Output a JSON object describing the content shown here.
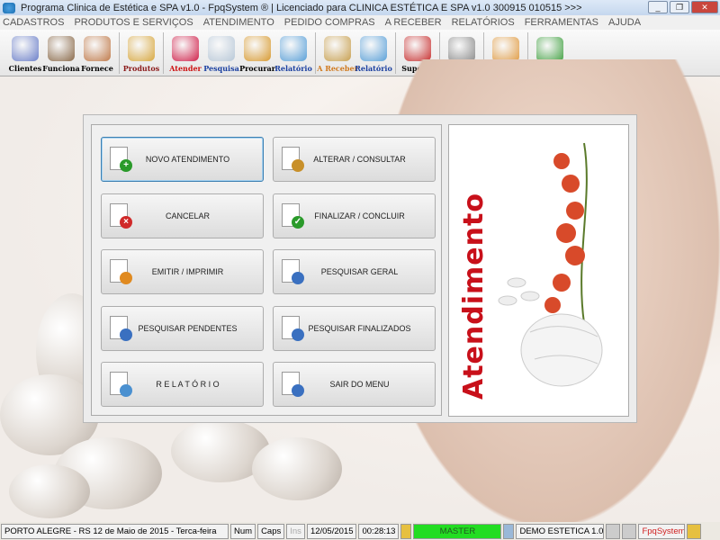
{
  "title": "Programa Clinica de Estética e SPA v1.0 - FpqSystem ® | Licenciado para  CLINICA ESTÉTICA E SPA v1.0 300915 010515 >>>",
  "window_buttons": {
    "minimize": "_",
    "restore": "❐",
    "close": "✕"
  },
  "menu": [
    "CADASTROS",
    "PRODUTOS E SERVIÇOS",
    "ATENDIMENTO",
    "PEDIDO COMPRAS",
    "A RECEBER",
    "RELATÓRIOS",
    "FERRAMENTAS",
    "AJUDA"
  ],
  "toolbar": [
    {
      "label": "Clientes",
      "color": "#000000",
      "icon": "#6b7fc9"
    },
    {
      "label": "Funciona",
      "color": "#000000",
      "icon": "#8a6a4a"
    },
    {
      "label": "Fornece",
      "color": "#000000",
      "icon": "#c07a4a"
    },
    {
      "label": "Produtos",
      "color": "#8b1a1a",
      "icon": "#d8a840"
    },
    {
      "label": "Atender",
      "color": "#cc1111",
      "icon": "#d0204a"
    },
    {
      "label": "Pesquisa",
      "color": "#1a3fa0",
      "icon": "#b8c8d8"
    },
    {
      "label": "Procurar",
      "color": "#000000",
      "icon": "#d89a30"
    },
    {
      "label": "Relatório",
      "color": "#1a3fa0",
      "icon": "#5aa0d8"
    },
    {
      "label": "A Receber",
      "color": "#d07a20",
      "icon": "#c8a050"
    },
    {
      "label": "Relatório",
      "color": "#1a3fa0",
      "icon": "#5aa0d8"
    },
    {
      "label": "Suporte",
      "color": "#000000",
      "icon": "#c83030"
    }
  ],
  "buttons": [
    {
      "label": "NOVO ATENDIMENTO",
      "icon": "new-document-icon",
      "badge": "+",
      "badge_color": "#2a9a2a"
    },
    {
      "label": "ALTERAR  /  CONSULTAR",
      "icon": "edit-pencil-icon",
      "badge": "",
      "badge_color": "#c8902a"
    },
    {
      "label": "CANCELAR",
      "icon": "cancel-document-icon",
      "badge": "×",
      "badge_color": "#d02a2a"
    },
    {
      "label": "FINALIZAR  /  CONCLUIR",
      "icon": "finalize-document-icon",
      "badge": "✓",
      "badge_color": "#2a9a2a"
    },
    {
      "label": "EMITIR  /  IMPRIMIR",
      "icon": "print-person-icon",
      "badge": "",
      "badge_color": "#e08a20"
    },
    {
      "label": "PESQUISAR GERAL",
      "icon": "search-chart-icon",
      "badge": "",
      "badge_color": "#3a70c0"
    },
    {
      "label": "PESQUISAR PENDENTES",
      "icon": "search-pending-icon",
      "badge": "",
      "badge_color": "#3a70c0"
    },
    {
      "label": "PESQUISAR FINALIZADOS",
      "icon": "search-finished-icon",
      "badge": "",
      "badge_color": "#3a70c0"
    },
    {
      "label": "R E L A T Ó R I O",
      "icon": "printer-icon",
      "badge": "",
      "badge_color": "#4a90d0"
    },
    {
      "label": "SAIR DO MENU",
      "icon": "exit-icon",
      "badge": "",
      "badge_color": "#3a70c0"
    }
  ],
  "panel_title": "Atendimento",
  "status": {
    "location": "PORTO ALEGRE - RS 12 de Maio de 2015 - Terca-feira",
    "num": "Num",
    "caps": "Caps",
    "ins": "Ins",
    "date": "12/05/2015",
    "time": "00:28:13",
    "user": "MASTER",
    "database": "DEMO ESTETICA 1.0",
    "brand": "FpqSystem"
  }
}
